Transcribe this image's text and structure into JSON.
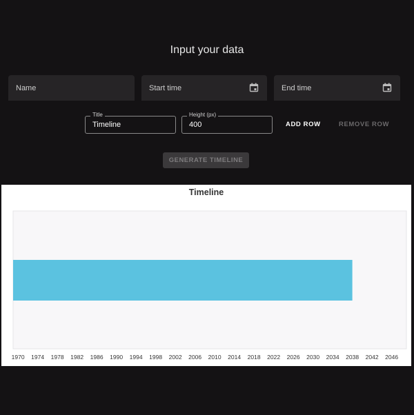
{
  "form": {
    "heading": "Input your data",
    "name_placeholder": "Name",
    "start_placeholder": "Start time",
    "end_placeholder": "End time",
    "calendar_icon": "calendar-icon",
    "title_label": "Title",
    "title_value": "Timeline",
    "height_label": "Height (px)",
    "height_value": "400",
    "add_row": "ADD ROW",
    "remove_row": "REMOVE ROW",
    "generate": "GENERATE TIMELINE"
  },
  "colors": {
    "background": "#141214",
    "field": "#262426",
    "bar": "#5bc2e0",
    "plot_area": "#f8f7f9"
  },
  "chart_data": {
    "type": "bar",
    "orientation": "horizontal",
    "title": "Timeline",
    "xlim": [
      1969,
      2049
    ],
    "x_ticks": [
      "1970",
      "1974",
      "1978",
      "1982",
      "1986",
      "1990",
      "1994",
      "1998",
      "2002",
      "2006",
      "2010",
      "2014",
      "2018",
      "2022",
      "2026",
      "2030",
      "2034",
      "2038",
      "2042",
      "2046"
    ],
    "bars": [
      {
        "start": 1969,
        "end": 2038
      }
    ],
    "grid": false
  }
}
